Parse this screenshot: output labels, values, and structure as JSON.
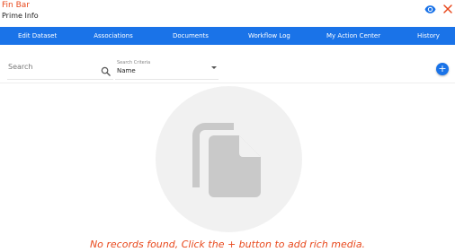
{
  "header": {
    "app_title": "Fin Bar",
    "subtitle": "Prime Info",
    "view_icon": "eye-icon",
    "close_icon": "close-icon"
  },
  "nav": {
    "items": [
      "Edit Dataset",
      "Associations",
      "Documents",
      "Workflow Log",
      "My Action Center",
      "History"
    ]
  },
  "search": {
    "placeholder": "Search",
    "icon": "search-icon"
  },
  "criteria": {
    "caption": "Search Criteria",
    "value": "Name"
  },
  "add_button": {
    "label": "+"
  },
  "empty_state": {
    "icon": "documents-icon",
    "message": "No records found, Click the + button to add rich media."
  },
  "colors": {
    "brand_orange": "#e8491d",
    "nav_blue": "#1a73e8",
    "circle_gray": "#f1f1f1",
    "icon_gray": "#c9c9c9"
  }
}
